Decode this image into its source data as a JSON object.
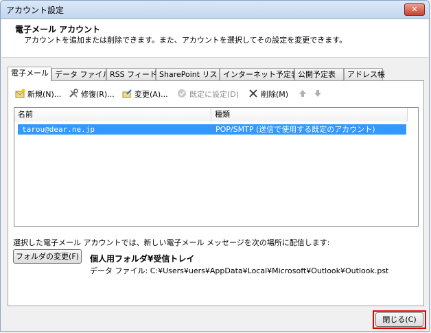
{
  "window": {
    "title": "アカウント設定",
    "close_glyph": "✕"
  },
  "header": {
    "title": "電子メール アカウント",
    "description": "アカウントを追加または削除できます。また、アカウントを選択してその設定を変更できます。"
  },
  "tabs": [
    {
      "label": "電子メール",
      "active": true
    },
    {
      "label": "データ ファイル",
      "active": false
    },
    {
      "label": "RSS フィード",
      "active": false
    },
    {
      "label": "SharePoint リスト",
      "active": false
    },
    {
      "label": "インターネット予定表",
      "active": false
    },
    {
      "label": "公開予定表",
      "active": false
    },
    {
      "label": "アドレス帳",
      "active": false
    }
  ],
  "toolbar": {
    "new_label": "新規(N)...",
    "repair_label": "修復(R)...",
    "change_label": "変更(A)...",
    "default_label": "既定に設定(D)",
    "delete_label": "削除(M)",
    "icons": {
      "new": "new-account-icon",
      "repair": "repair-icon",
      "change": "change-icon",
      "default": "check-circle-icon",
      "delete": "x-icon",
      "up": "arrow-up-icon",
      "down": "arrow-down-icon"
    }
  },
  "account_list": {
    "columns": [
      "名前",
      "種類"
    ],
    "rows": [
      {
        "name": "tarou@dear.ne.jp",
        "type": "POP/SMTP (送信で使用する既定のアカウント)",
        "selected": true
      }
    ]
  },
  "delivery": {
    "text": "選択した電子メール アカウントでは、新しい電子メール メッセージを次の場所に配信します:",
    "change_folder_label": "フォルダの変更(F)",
    "folder_name": "個人用フォルダ¥受信トレイ",
    "folder_path": "データ ファイル: C:¥Users¥uers¥AppData¥Local¥Microsoft¥Outlook¥Outlook.pst"
  },
  "footer": {
    "close_label": "閉じる(C)"
  },
  "colors": {
    "selection": "#3399ff",
    "highlight": "#e00000"
  }
}
